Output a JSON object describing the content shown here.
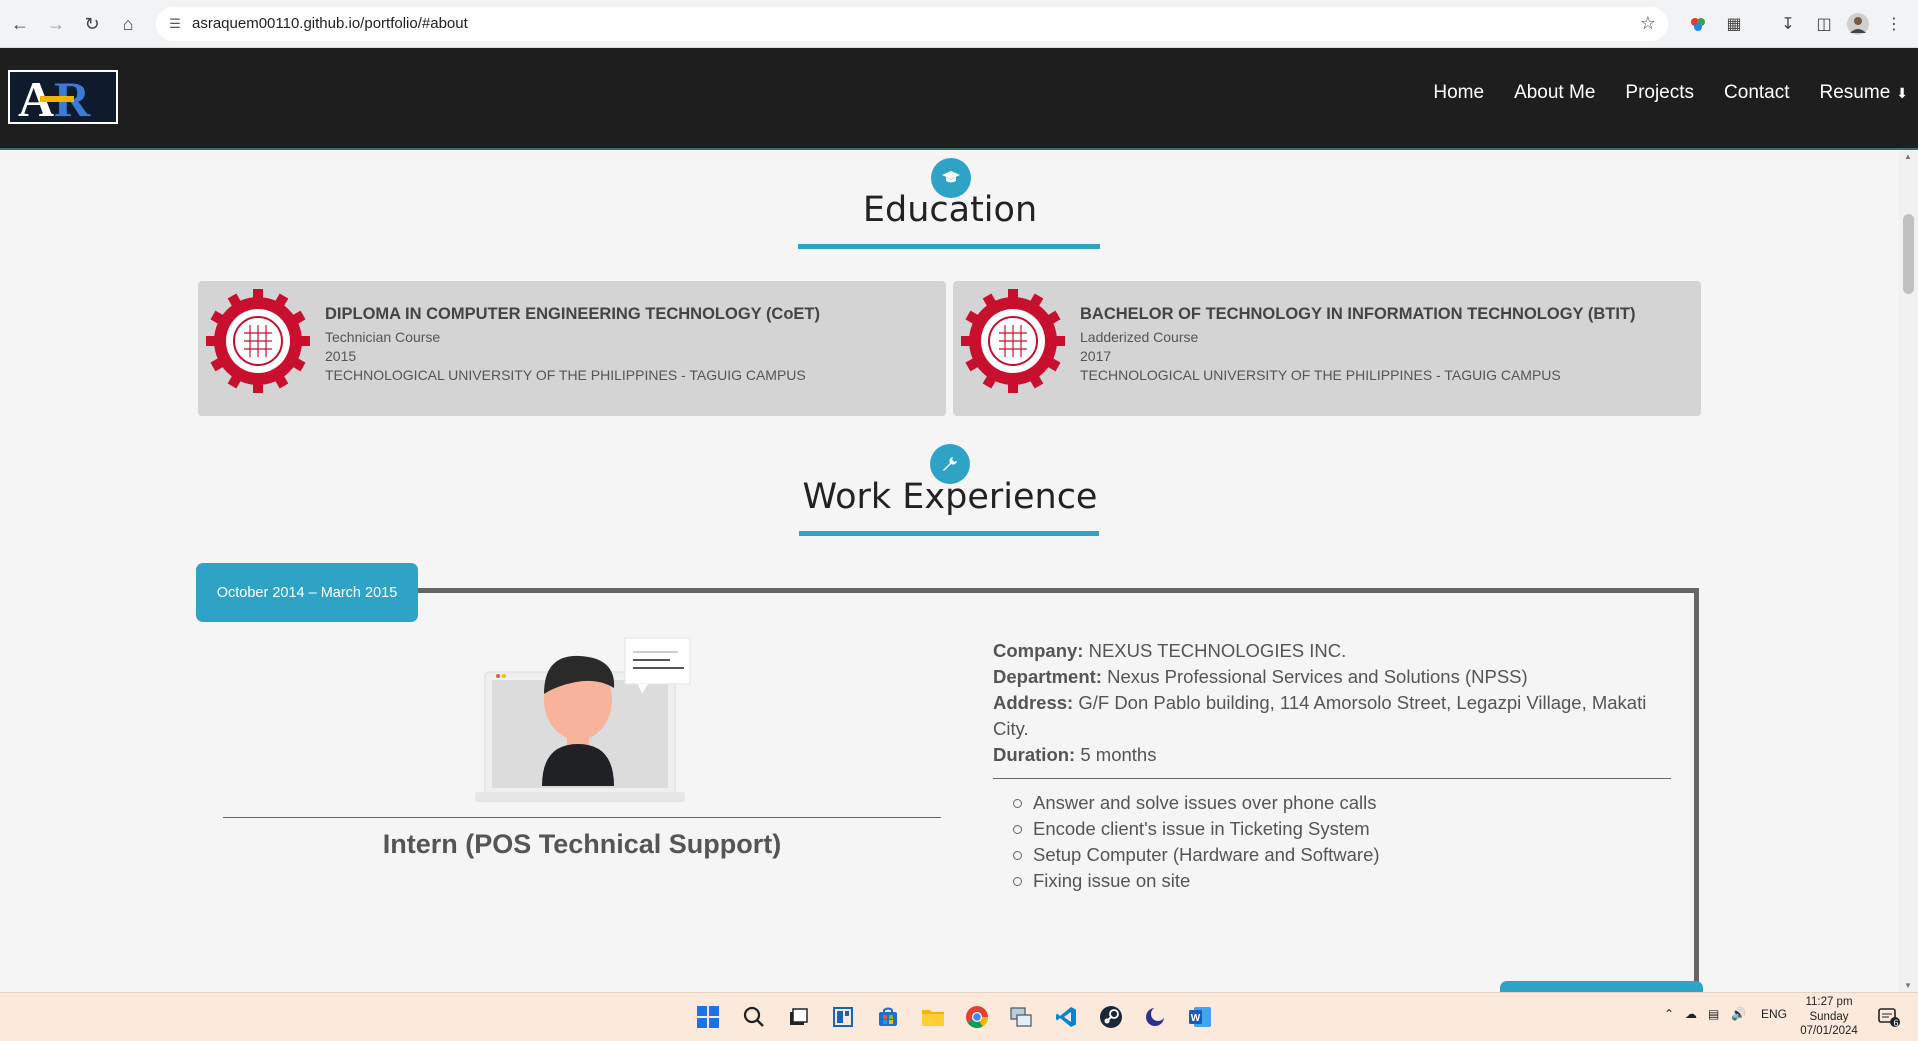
{
  "browser": {
    "url": "asraquem00110.github.io/portfolio/#about"
  },
  "nav": {
    "logo_text_1": "A",
    "logo_text_2": "R",
    "links": [
      "Home",
      "About Me",
      "Projects",
      "Contact",
      "Resume"
    ]
  },
  "education": {
    "heading": "Education",
    "cards": [
      {
        "title": "DIPLOMA IN COMPUTER ENGINEERING TECHNOLOGY (CoET)",
        "course": "Technician Course",
        "year": "2015",
        "school": "TECHNOLOGICAL UNIVERSITY OF THE PHILIPPINES - TAGUIG CAMPUS"
      },
      {
        "title": "BACHELOR OF TECHNOLOGY IN INFORMATION TECHNOLOGY (BTIT)",
        "course": "Ladderized Course",
        "year": "2017",
        "school": "TECHNOLOGICAL UNIVERSITY OF THE PHILIPPINES - TAGUIG CAMPUS"
      }
    ]
  },
  "work": {
    "heading": "Work Experience",
    "date": "October 2014 – March 2015",
    "role": "Intern (POS Technical Support)",
    "company_label": "Company:",
    "company": "NEXUS TECHNOLOGIES INC.",
    "department_label": "Department:",
    "department": "Nexus Professional Services and Solutions (NPSS)",
    "address_label": "Address:",
    "address": "G/F Don Pablo building, 114 Amorsolo Street, Legazpi Village, Makati City.",
    "duration_label": "Duration:",
    "duration": "5 months",
    "duties": [
      "Answer and solve issues over phone calls",
      "Encode client's issue in Ticketing System",
      "Setup Computer (Hardware and Software)",
      "Fixing issue on site"
    ]
  },
  "taskbar": {
    "lang": "ENG",
    "time": "11:27 pm",
    "day": "Sunday",
    "date": "07/01/2024",
    "notif_count": "6"
  },
  "colors": {
    "accent": "#2fa3c6",
    "navbar": "#1e1e1e",
    "card": "#d4d4d4",
    "seal_red": "#c8102e"
  }
}
